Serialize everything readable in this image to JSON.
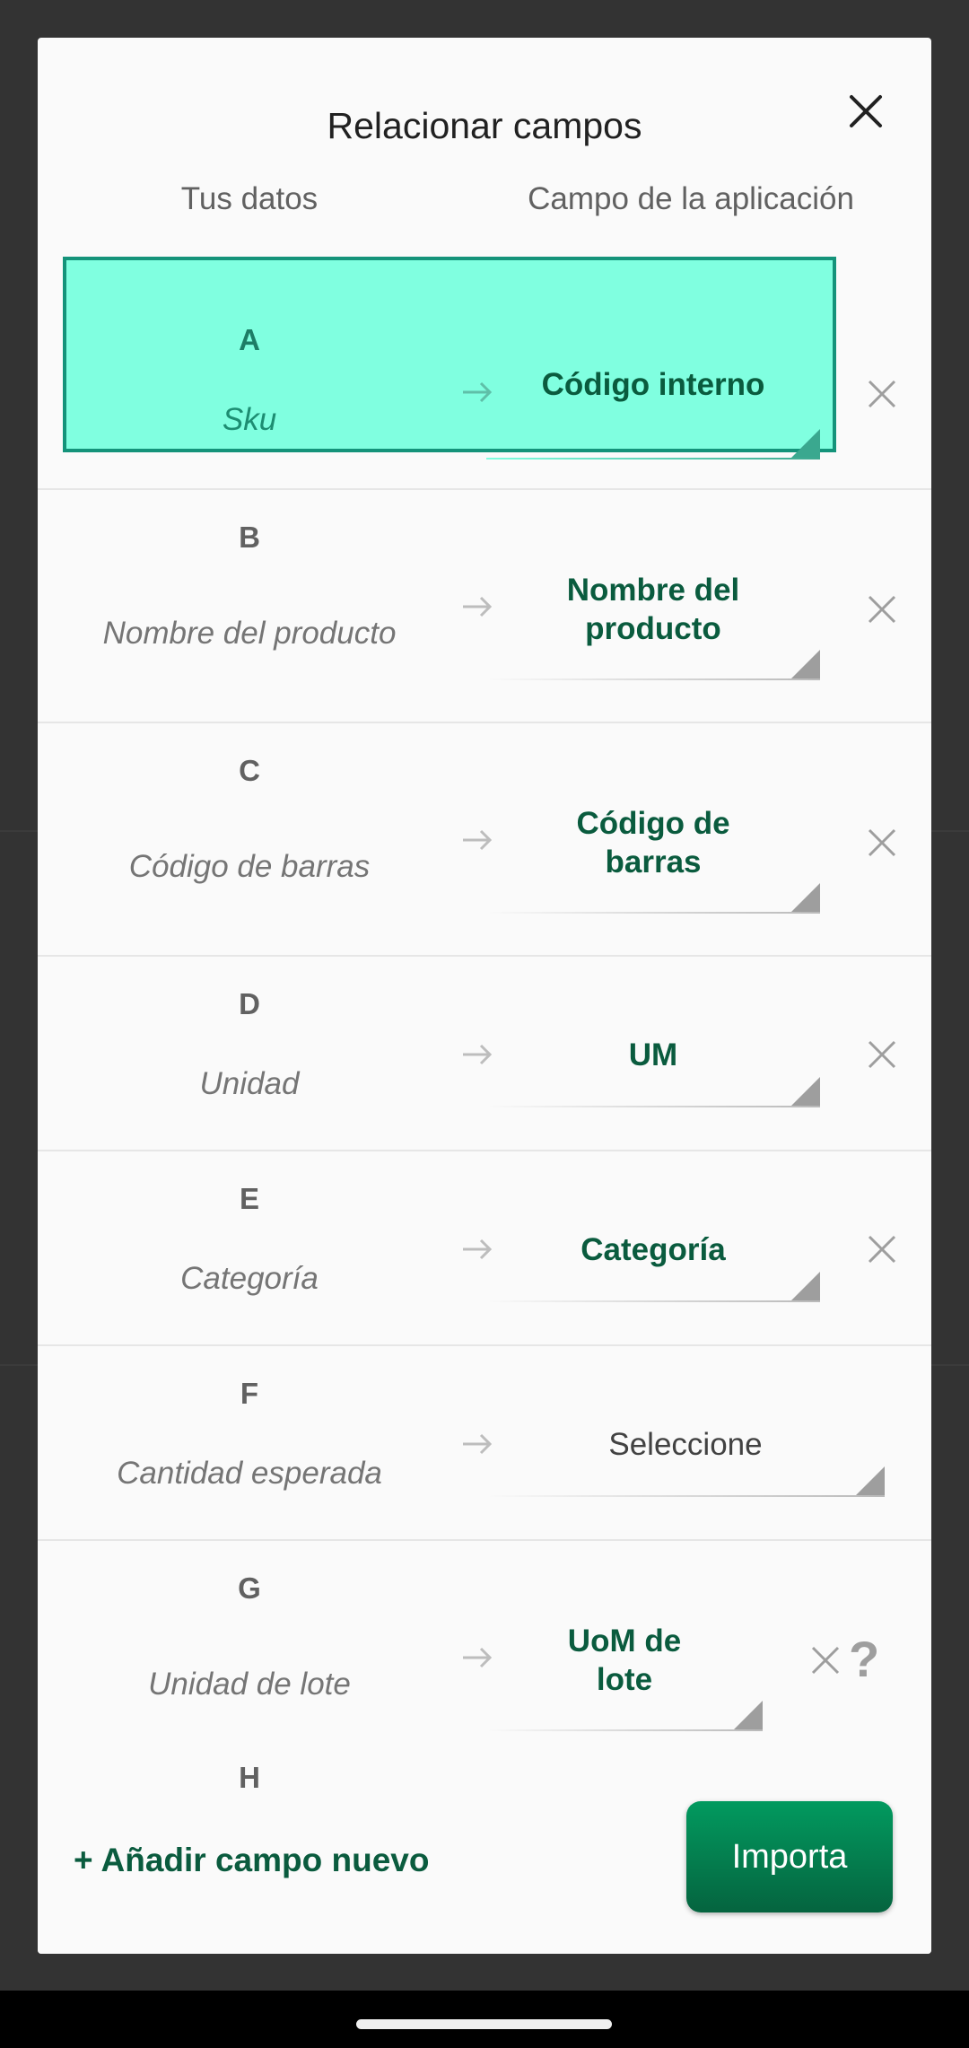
{
  "dialog": {
    "title": "Relacionar campos",
    "columns": {
      "your_data": "Tus datos",
      "app_field": "Campo de la aplicación"
    },
    "rows": [
      {
        "letter": "A",
        "name": "Sku",
        "mapped": "Código interno",
        "highlighted": true
      },
      {
        "letter": "B",
        "name": "Nombre del producto",
        "mapped": "Nombre del producto"
      },
      {
        "letter": "C",
        "name": "Código de barras",
        "mapped": "Código de barras"
      },
      {
        "letter": "D",
        "name": "Unidad",
        "mapped": "UM"
      },
      {
        "letter": "E",
        "name": "Categoría",
        "mapped": "Categoría"
      },
      {
        "letter": "F",
        "name": "Cantidad esperada",
        "mapped": "Seleccione",
        "placeholder": true
      },
      {
        "letter": "G",
        "name": "Unidad de lote",
        "mapped": "UoM de lote",
        "help": "?"
      }
    ],
    "partial_row_letter": "H"
  },
  "footer": {
    "add_field": "+ Añadir campo nuevo",
    "import": "Importa"
  },
  "colors": {
    "accent": "#0a5b3e",
    "highlight_fill": "#80ffe0",
    "highlight_border": "#14937a",
    "button_green": "#038a55"
  }
}
